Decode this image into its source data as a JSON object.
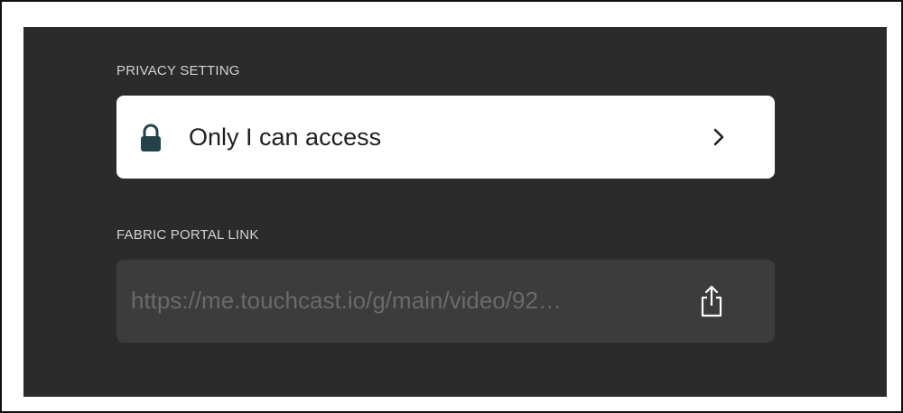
{
  "privacy": {
    "section_label": "PRIVACY SETTING",
    "value": "Only I can access",
    "icon": "lock-icon",
    "chevron": "chevron-right-icon"
  },
  "portal": {
    "section_label": "FABRIC PORTAL LINK",
    "link": "https://me.touchcast.io/g/main/video/92…",
    "icon": "share-icon"
  },
  "colors": {
    "panel_bg": "#2b2b2b",
    "label_text": "#d2d2d2",
    "row_bg": "#ffffff",
    "link_row_bg": "#3c3c3c",
    "link_text": "#6a6a6a",
    "lock_color": "#24424a"
  }
}
